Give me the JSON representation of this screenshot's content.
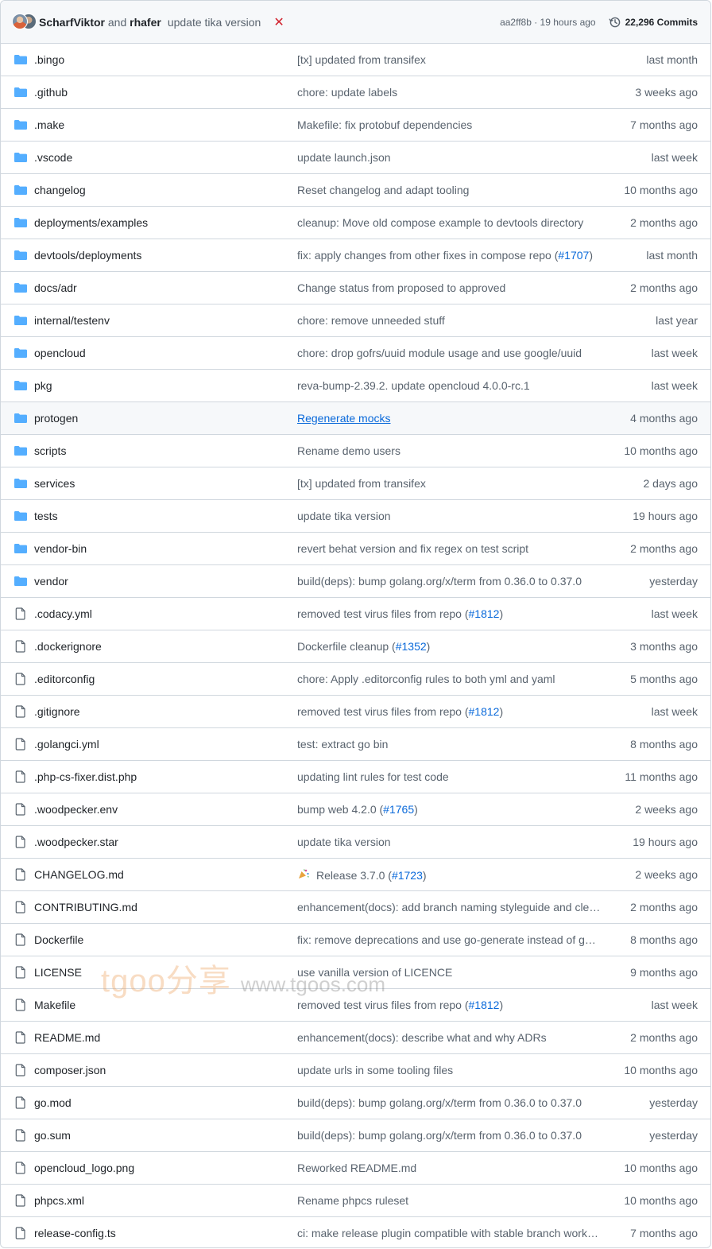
{
  "header": {
    "author1": "ScharfViktor",
    "and_text": "and",
    "author2": "rhafer",
    "commit_message": "update tika version",
    "status_mark": "✕",
    "sha_age": "aa2ff8b · 19 hours ago",
    "commits_label": "22,296 Commits"
  },
  "colors": {
    "folder": "#54aeff",
    "link": "#0969da",
    "muted": "#59636e",
    "fail": "#d1242f"
  },
  "rows": [
    {
      "type": "folder",
      "name": ".bingo",
      "msg": "[tx] updated from transifex",
      "ref": "",
      "age": "last month"
    },
    {
      "type": "folder",
      "name": ".github",
      "msg": "chore: update labels",
      "ref": "",
      "age": "3 weeks ago"
    },
    {
      "type": "folder",
      "name": ".make",
      "msg": "Makefile: fix protobuf dependencies",
      "ref": "",
      "age": "7 months ago"
    },
    {
      "type": "folder",
      "name": ".vscode",
      "msg": "update launch.json",
      "ref": "",
      "age": "last week"
    },
    {
      "type": "folder",
      "name": "changelog",
      "msg": "Reset changelog and adapt tooling",
      "ref": "",
      "age": "10 months ago"
    },
    {
      "type": "folder",
      "name": "deployments/examples",
      "msg": "cleanup: Move old compose example to devtools directory",
      "ref": "",
      "age": "2 months ago"
    },
    {
      "type": "folder",
      "name": "devtools/deployments",
      "msg": "fix: apply changes from other fixes in compose repo (",
      "ref": "#1707",
      "age": "last month"
    },
    {
      "type": "folder",
      "name": "docs/adr",
      "msg": "Change status from proposed to approved",
      "ref": "",
      "age": "2 months ago"
    },
    {
      "type": "folder",
      "name": "internal/testenv",
      "msg": "chore: remove unneeded stuff",
      "ref": "",
      "age": "last year"
    },
    {
      "type": "folder",
      "name": "opencloud",
      "msg": "chore: drop gofrs/uuid module usage and use google/uuid",
      "ref": "",
      "age": "last week"
    },
    {
      "type": "folder",
      "name": "pkg",
      "msg": "reva-bump-2.39.2. update opencloud 4.0.0-rc.1",
      "ref": "",
      "age": "last week"
    },
    {
      "type": "folder",
      "name": "protogen",
      "msg": "Regenerate mocks",
      "ref": "",
      "age": "4 months ago",
      "hover": true
    },
    {
      "type": "folder",
      "name": "scripts",
      "msg": "Rename demo users",
      "ref": "",
      "age": "10 months ago"
    },
    {
      "type": "folder",
      "name": "services",
      "msg": "[tx] updated from transifex",
      "ref": "",
      "age": "2 days ago"
    },
    {
      "type": "folder",
      "name": "tests",
      "msg": "update tika version",
      "ref": "",
      "age": "19 hours ago"
    },
    {
      "type": "folder",
      "name": "vendor-bin",
      "msg": "revert behat version and fix regex on test script",
      "ref": "",
      "age": "2 months ago"
    },
    {
      "type": "folder",
      "name": "vendor",
      "msg": "build(deps): bump golang.org/x/term from 0.36.0 to 0.37.0",
      "ref": "",
      "age": "yesterday"
    },
    {
      "type": "file",
      "name": ".codacy.yml",
      "msg": "removed test virus files from repo (",
      "ref": "#1812",
      "age": "last week"
    },
    {
      "type": "file",
      "name": ".dockerignore",
      "msg": "Dockerfile cleanup (",
      "ref": "#1352",
      "age": "3 months ago"
    },
    {
      "type": "file",
      "name": ".editorconfig",
      "msg": "chore: Apply .editorconfig rules to both yml and yaml",
      "ref": "",
      "age": "5 months ago"
    },
    {
      "type": "file",
      "name": ".gitignore",
      "msg": "removed test virus files from repo (",
      "ref": "#1812",
      "age": "last week"
    },
    {
      "type": "file",
      "name": ".golangci.yml",
      "msg": "test: extract go bin",
      "ref": "",
      "age": "8 months ago"
    },
    {
      "type": "file",
      "name": ".php-cs-fixer.dist.php",
      "msg": "updating lint rules for test code",
      "ref": "",
      "age": "11 months ago"
    },
    {
      "type": "file",
      "name": ".woodpecker.env",
      "msg": "bump web 4.2.0 (",
      "ref": "#1765",
      "age": "2 weeks ago"
    },
    {
      "type": "file",
      "name": ".woodpecker.star",
      "msg": "update tika version",
      "ref": "",
      "age": "19 hours ago"
    },
    {
      "type": "file",
      "name": "CHANGELOG.md",
      "msg": "Release 3.7.0 (",
      "ref": "#1723",
      "age": "2 weeks ago",
      "party": true
    },
    {
      "type": "file",
      "name": "CONTRIBUTING.md",
      "msg": "enhancement(docs): add branch naming styleguide and clea…",
      "ref": "",
      "age": "2 months ago"
    },
    {
      "type": "file",
      "name": "Dockerfile",
      "msg": "fix: remove deprecations and use go-generate instead of go…",
      "ref": "",
      "age": "8 months ago"
    },
    {
      "type": "file",
      "name": "LICENSE",
      "msg": "use vanilla version of LICENCE",
      "ref": "",
      "age": "9 months ago"
    },
    {
      "type": "file",
      "name": "Makefile",
      "msg": "removed test virus files from repo (",
      "ref": "#1812",
      "age": "last week"
    },
    {
      "type": "file",
      "name": "README.md",
      "msg": "enhancement(docs): describe what and why ADRs",
      "ref": "",
      "age": "2 months ago"
    },
    {
      "type": "file",
      "name": "composer.json",
      "msg": "update urls in some tooling files",
      "ref": "",
      "age": "10 months ago"
    },
    {
      "type": "file",
      "name": "go.mod",
      "msg": "build(deps): bump golang.org/x/term from 0.36.0 to 0.37.0",
      "ref": "",
      "age": "yesterday"
    },
    {
      "type": "file",
      "name": "go.sum",
      "msg": "build(deps): bump golang.org/x/term from 0.36.0 to 0.37.0",
      "ref": "",
      "age": "yesterday"
    },
    {
      "type": "file",
      "name": "opencloud_logo.png",
      "msg": "Reworked README.md",
      "ref": "",
      "age": "10 months ago"
    },
    {
      "type": "file",
      "name": "phpcs.xml",
      "msg": "Rename phpcs ruleset",
      "ref": "",
      "age": "10 months ago"
    },
    {
      "type": "file",
      "name": "release-config.ts",
      "msg": "ci: make release plugin compatible with stable branch workfl…",
      "ref": "",
      "age": "7 months ago"
    }
  ],
  "watermark": {
    "brand": "tgoo分享",
    "url": "www.tgoos.com"
  }
}
